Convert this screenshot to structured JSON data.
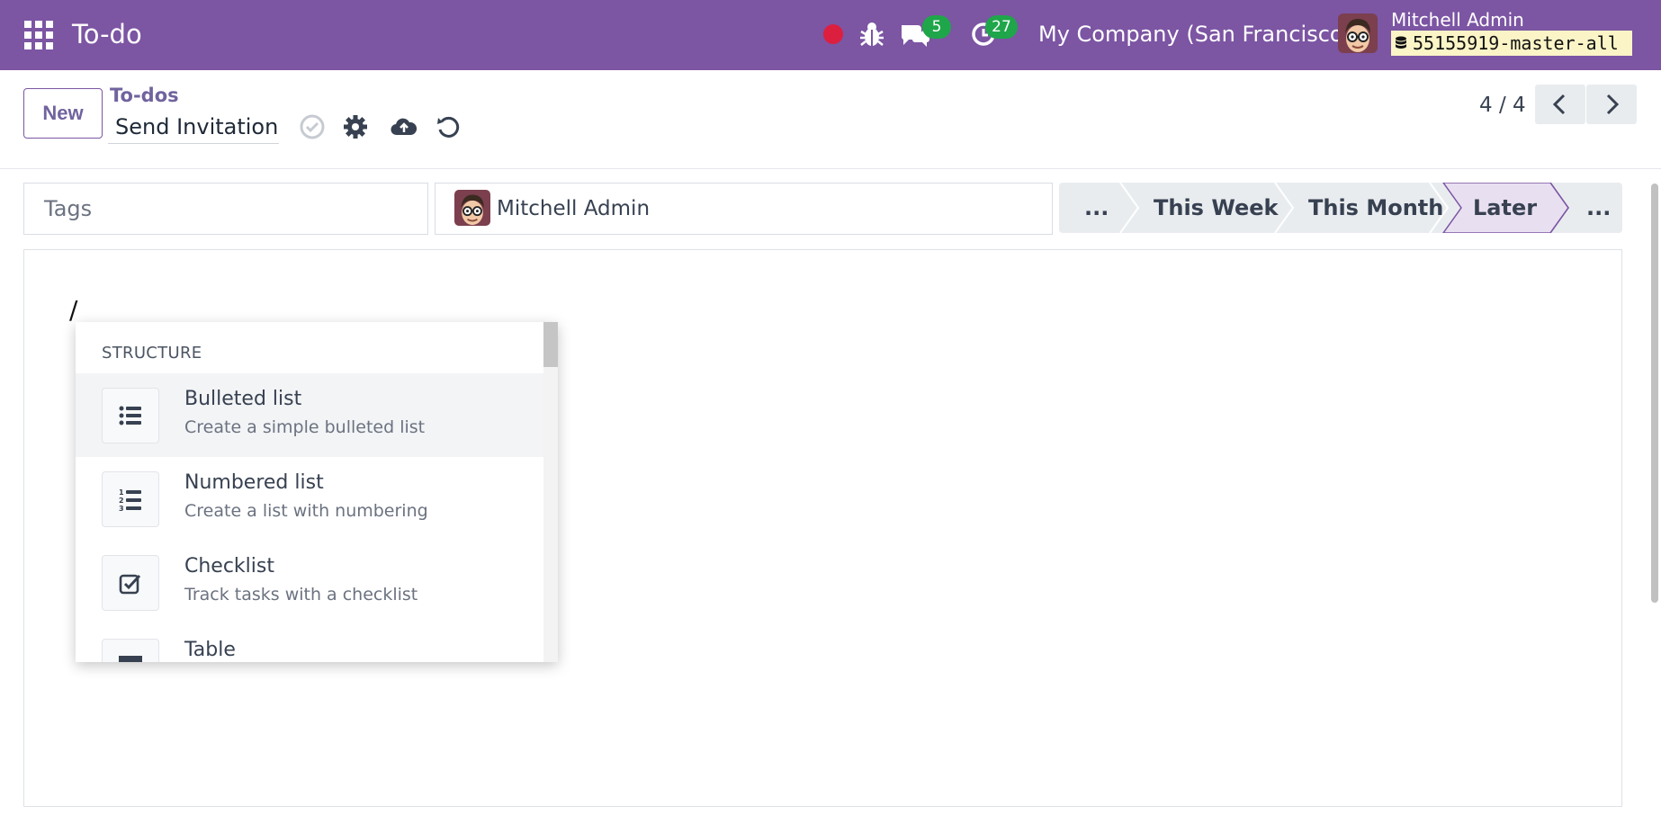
{
  "navbar": {
    "app_title": "To-do",
    "chat_count": "5",
    "activity_count": "27",
    "company": "My Company (San Francisco)",
    "user_name": "Mitchell Admin",
    "database": "55155919-master-all",
    "icons": [
      "apps-grid-icon",
      "recording-dot-icon",
      "bug-icon",
      "chat-icon",
      "clock-icon",
      "database-icon"
    ],
    "colors": {
      "navbar_bg": "#7c55a3",
      "badge_bg": "#1fa64a",
      "record_dot": "#dc1f3f"
    }
  },
  "control_panel": {
    "new_label": "New",
    "breadcrumb": "To-dos",
    "record_name": "Send Invitation",
    "pager": "4 / 4"
  },
  "form": {
    "tags_placeholder": "Tags",
    "assignee": "Mitchell Admin",
    "stages": [
      "...",
      "This Week",
      "This Month",
      "Later",
      "..."
    ],
    "active_stage": "Later",
    "editor_text": "/"
  },
  "powerbox": {
    "category": "STRUCTURE",
    "items": [
      {
        "title": "Bulleted list",
        "description": "Create a simple bulleted list",
        "icon": "bulleted-list-icon"
      },
      {
        "title": "Numbered list",
        "description": "Create a list with numbering",
        "icon": "numbered-list-icon"
      },
      {
        "title": "Checklist",
        "description": "Track tasks with a checklist",
        "icon": "checklist-icon"
      },
      {
        "title": "Table",
        "description": "",
        "icon": "table-icon"
      }
    ]
  }
}
